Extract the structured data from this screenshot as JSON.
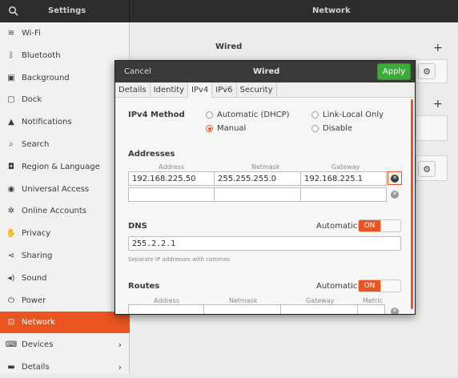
{
  "header": {
    "app_title": "Settings",
    "page_title": "Network"
  },
  "sidebar": {
    "items": [
      {
        "label": "Wi-Fi",
        "icon": "wifi-icon",
        "glyph": "≋"
      },
      {
        "label": "Bluetooth",
        "icon": "bluetooth-icon",
        "glyph": "ᛒ"
      },
      {
        "label": "Background",
        "icon": "background-icon",
        "glyph": "▣"
      },
      {
        "label": "Dock",
        "icon": "dock-icon",
        "glyph": "▢"
      },
      {
        "label": "Notifications",
        "icon": "bell-icon",
        "glyph": "▲"
      },
      {
        "label": "Search",
        "icon": "search-icon",
        "glyph": "⌕"
      },
      {
        "label": "Region & Language",
        "icon": "camera-icon",
        "glyph": "◘"
      },
      {
        "label": "Universal Access",
        "icon": "accessibility-icon",
        "glyph": "◉"
      },
      {
        "label": "Online Accounts",
        "icon": "online-accounts-icon",
        "glyph": "✲"
      },
      {
        "label": "Privacy",
        "icon": "hand-icon",
        "glyph": "✋"
      },
      {
        "label": "Sharing",
        "icon": "share-icon",
        "glyph": "⋖"
      },
      {
        "label": "Sound",
        "icon": "speaker-icon",
        "glyph": "◂)"
      },
      {
        "label": "Power",
        "icon": "power-icon",
        "glyph": "⏻"
      },
      {
        "label": "Network",
        "icon": "network-icon",
        "glyph": "⊡"
      },
      {
        "label": "Devices",
        "icon": "devices-icon",
        "glyph": "⌨"
      },
      {
        "label": "Details",
        "icon": "details-icon",
        "glyph": "▬"
      }
    ],
    "active_index": 13
  },
  "main": {
    "wired_heading": "Wired",
    "plus": "+"
  },
  "dialog": {
    "cancel_label": "Cancel",
    "title": "Wired",
    "apply_label": "Apply",
    "tabs": [
      "Details",
      "Identity",
      "IPv4",
      "IPv6",
      "Security"
    ],
    "active_tab": "IPv4",
    "ipv4_method_label": "IPv4 Method",
    "methods": [
      {
        "label": "Automatic (DHCP)",
        "selected": false
      },
      {
        "label": "Link-Local Only",
        "selected": false
      },
      {
        "label": "Manual",
        "selected": true
      },
      {
        "label": "Disable",
        "selected": false
      }
    ],
    "addresses_label": "Addresses",
    "address_columns": [
      "Address",
      "Netmask",
      "Gateway"
    ],
    "address_rows": [
      {
        "address": "192.168.225.50",
        "netmask": "255.255.255.0",
        "gateway": "192.168.225.1"
      },
      {
        "address": "",
        "netmask": "",
        "gateway": ""
      }
    ],
    "dns_label": "DNS",
    "dns_automatic_label": "Automatic",
    "dns_automatic_state": "ON",
    "dns_value": "255.2.2.1",
    "dns_hint": "Separate IP addresses with commas",
    "routes_label": "Routes",
    "routes_automatic_label": "Automatic",
    "routes_automatic_state": "ON",
    "route_columns": [
      "Address",
      "Netmask",
      "Gateway",
      "Metric"
    ]
  },
  "colors": {
    "accent": "#e95420",
    "apply_green": "#3cab3a",
    "header_dark": "#2d2d2d"
  }
}
